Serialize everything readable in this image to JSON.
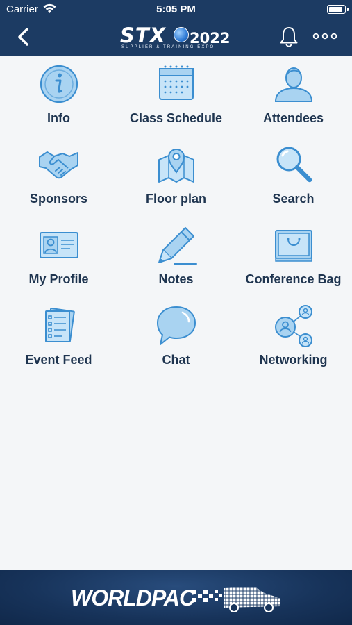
{
  "status_bar": {
    "carrier": "Carrier",
    "time": "5:05 PM",
    "battery_level": 0.95
  },
  "header": {
    "logo_main": "STX",
    "logo_year": "2022",
    "logo_sub": "SUPPLIER & TRAINING EXPO",
    "icons": [
      "back-chevron-icon",
      "bell-icon",
      "more-dots-icon"
    ]
  },
  "menu": [
    {
      "label": "Info",
      "icon": "info-icon"
    },
    {
      "label": "Class Schedule",
      "icon": "calendar-icon"
    },
    {
      "label": "Attendees",
      "icon": "person-icon"
    },
    {
      "label": "Sponsors",
      "icon": "handshake-icon"
    },
    {
      "label": "Floor plan",
      "icon": "map-pin-icon"
    },
    {
      "label": "Search",
      "icon": "magnifier-icon"
    },
    {
      "label": "My Profile",
      "icon": "id-card-icon"
    },
    {
      "label": "Notes",
      "icon": "pen-icon"
    },
    {
      "label": "Conference Bag",
      "icon": "bag-icon"
    },
    {
      "label": "Event Feed",
      "icon": "document-stack-icon"
    },
    {
      "label": "Chat",
      "icon": "chat-bubble-icon"
    },
    {
      "label": "Networking",
      "icon": "network-icon"
    }
  ],
  "footer": {
    "brand": "WORLDPAC"
  },
  "colors": {
    "header": "#1c3b63",
    "icon_fill": "#a9d3f1",
    "icon_stroke": "#3b8ed0",
    "label": "#1f3550",
    "background": "#f4f6f8"
  }
}
